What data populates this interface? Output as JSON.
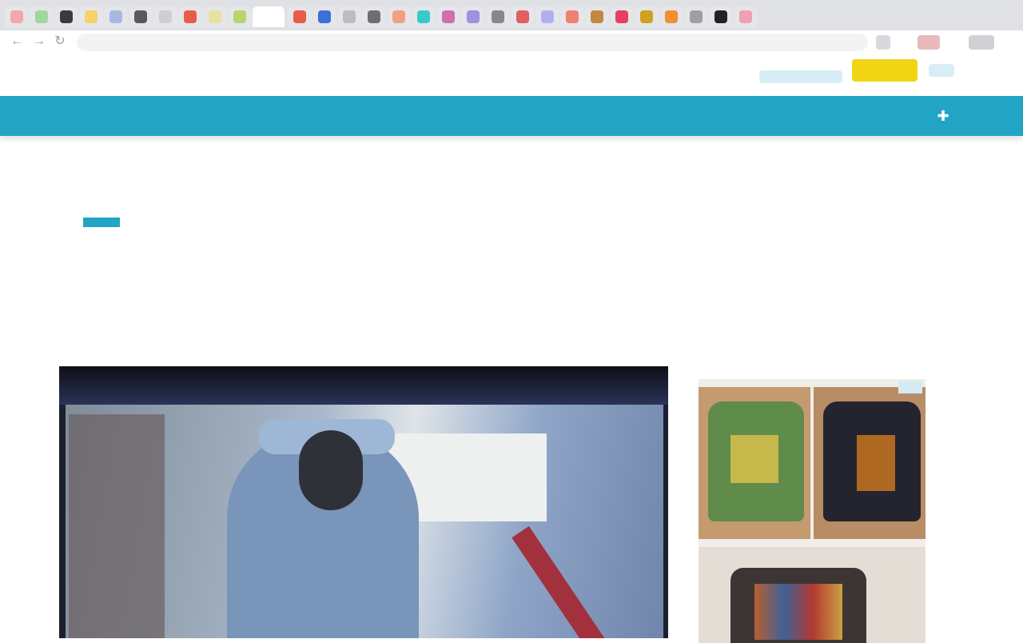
{
  "browser": {
    "tab_colors": [
      "#f4a7a7",
      "#9fd79f",
      "#3b3b3b",
      "#f5d26a",
      "#a8b8e0",
      "#5a5a5a",
      "#cfcfcf",
      "#e85c4a",
      "#e8e0a0",
      "#b7d66b",
      "#ffffff",
      "#e85c4a",
      "#3b6fd9",
      "#bdbdbd",
      "#6e6e6e",
      "#f0a080",
      "#3ac9c9",
      "#d070a8",
      "#a090e0",
      "#888888",
      "#e06060",
      "#b0b0f0",
      "#f08070",
      "#c08840",
      "#e84060",
      "#d0a020",
      "#f09030",
      "#a0a0a0",
      "#222222",
      "#f0a0b0"
    ],
    "url": "",
    "back_icon": "arrow-left-icon",
    "forward_icon": "arrow-right-icon",
    "reload_icon": "reload-icon"
  },
  "site": {
    "logo_text": "",
    "subscribe_label": "",
    "accent_color": "#22a4c4",
    "subscribe_color": "#f1d515",
    "nav_links": [
      "",
      "",
      "",
      "",
      "",
      "",
      ""
    ],
    "search_icon": "search-icon"
  },
  "article": {
    "section": "",
    "byline": "",
    "headline": "",
    "summary": ""
  },
  "video": {
    "channel": ""
  },
  "ad": {
    "choice_label": ""
  }
}
